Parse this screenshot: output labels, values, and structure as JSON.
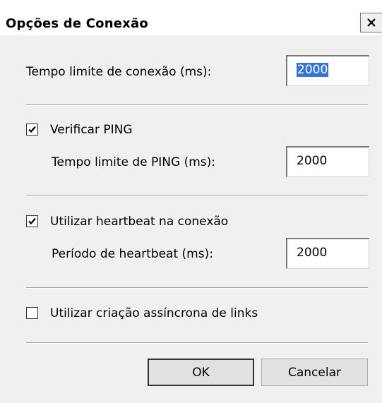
{
  "window": {
    "title": "Opções de Conexão",
    "close_label": "X"
  },
  "connection_timeout": {
    "label": "Tempo limite de conexão (ms):",
    "value": "2000"
  },
  "ping": {
    "checkbox_label": "Verificar PING",
    "checked": true,
    "timeout_label": "Tempo limite de PING (ms):",
    "timeout_value": "2000"
  },
  "heartbeat": {
    "checkbox_label": "Utilizar heartbeat na conexão",
    "checked": true,
    "period_label": "Período de heartbeat (ms):",
    "period_value": "2000"
  },
  "async_links": {
    "checkbox_label": "Utilizar criação assíncrona de links",
    "checked": false
  },
  "buttons": {
    "ok": "OK",
    "cancel": "Cancelar"
  }
}
